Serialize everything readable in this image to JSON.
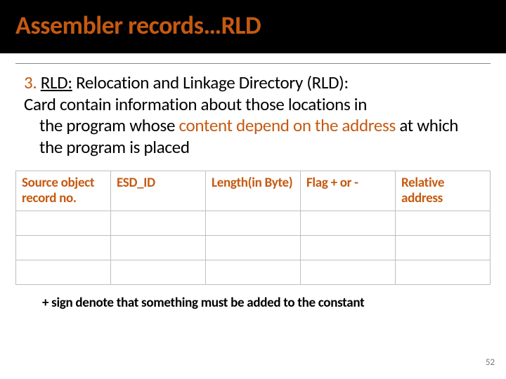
{
  "title": "Assembler records…RLD",
  "body": {
    "lead_num": "3.",
    "lead_term": "RLD:",
    "lead_rest": " Relocation and Linkage Directory (RLD):",
    "line_card": "Card contain information about those locations in",
    "line_prog1": "the program whose ",
    "line_emph": "content depend on the address",
    "line_prog2": " at which the program is placed"
  },
  "table": {
    "headers": [
      "Source object record no.",
      "ESD_ID",
      "Length(in Byte)",
      "Flag + or -",
      "Relative address"
    ],
    "rows": [
      [
        "",
        "",
        "",
        "",
        ""
      ],
      [
        "",
        "",
        "",
        "",
        ""
      ],
      [
        "",
        "",
        "",
        "",
        ""
      ]
    ]
  },
  "footnote": "+ sign denote that something must be added to the constant",
  "page_number": "52"
}
